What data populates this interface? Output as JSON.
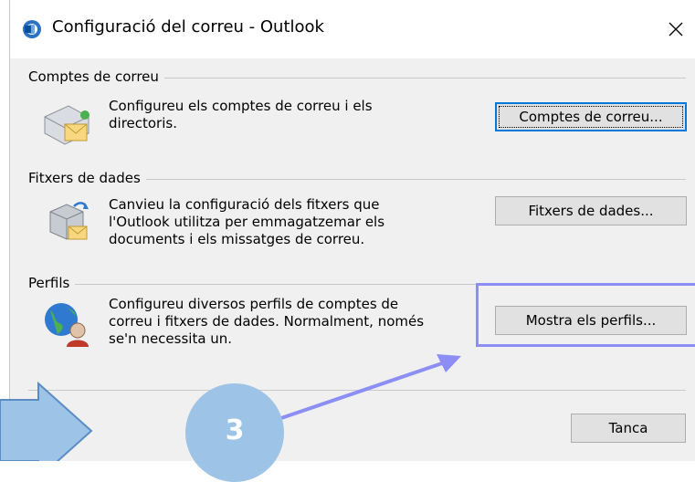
{
  "window": {
    "title": "Configuració del correu - Outlook",
    "close_glyph": "✕"
  },
  "groups": {
    "accounts": {
      "label": "Comptes de correu",
      "desc_lines": [
        "Configureu els comptes de correu i els",
        "directoris."
      ],
      "button": "Comptes de correu..."
    },
    "datafiles": {
      "label": "Fitxers de dades",
      "desc_lines": [
        "Canvieu la configuració dels fitxers que",
        "l'Outlook utilitza per emmagatzemar els",
        "documents i els missatges de correu."
      ],
      "button": "Fitxers de dades..."
    },
    "profiles": {
      "label": "Perfils",
      "desc_lines": [
        "Configureu diversos perfils de comptes de",
        "correu i fitxers de dades. Normalment, només",
        "se'n necessita un."
      ],
      "button": "Mostra els perfils..."
    }
  },
  "footer": {
    "close_button": "Tanca"
  },
  "annotation": {
    "step_number": "3",
    "highlight_color": "#8c8ef5",
    "circle_color": "#9dc3e6",
    "arrow_color": "#8c8ef5"
  },
  "icons": {
    "title": "outlook-icon",
    "accounts": "mail-accounts-icon",
    "datafiles": "data-files-icon",
    "profiles": "profiles-icon"
  }
}
